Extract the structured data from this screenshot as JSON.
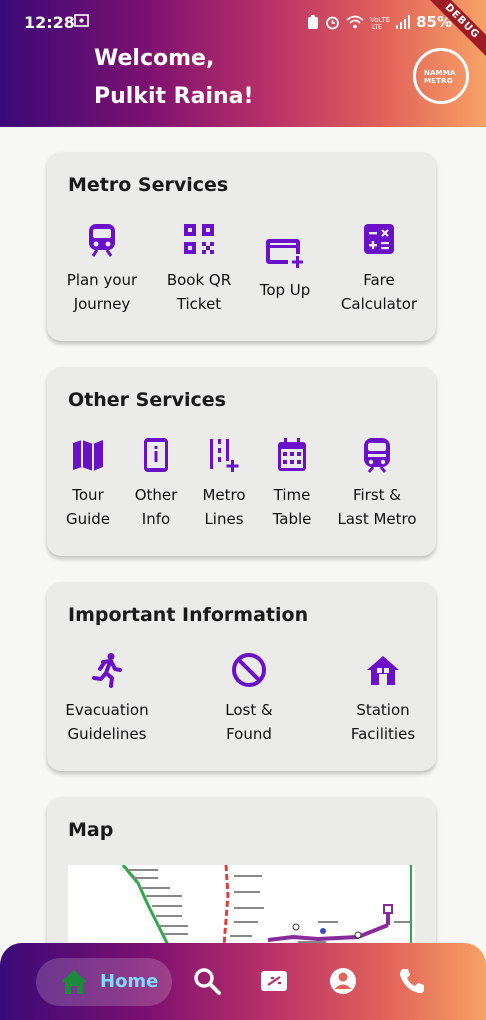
{
  "status": {
    "time": "12:28",
    "battery": "85%",
    "debug_banner": "DEBUG"
  },
  "header": {
    "welcome_line1": "Welcome,",
    "welcome_line2": "Pulkit Raina!",
    "logo_text_1": "NAMMA",
    "logo_text_2": "METRO"
  },
  "metro_services": {
    "title": "Metro Services",
    "items": [
      {
        "label": "Plan your\nJourney",
        "icon": "train-icon"
      },
      {
        "label": "Book QR\nTicket",
        "icon": "qr-code-icon"
      },
      {
        "label": "Top Up",
        "icon": "card-add-icon"
      },
      {
        "label": "Fare\nCalculator",
        "icon": "calculator-icon"
      }
    ]
  },
  "other_services": {
    "title": "Other Services",
    "items": [
      {
        "label": "Tour\nGuide",
        "icon": "map-icon"
      },
      {
        "label": "Other\nInfo",
        "icon": "info-phone-icon"
      },
      {
        "label": "Metro\nLines",
        "icon": "lines-add-icon"
      },
      {
        "label": "Time\nTable",
        "icon": "calendar-icon"
      },
      {
        "label": "First &\nLast Metro",
        "icon": "tram-icon"
      }
    ]
  },
  "important_info": {
    "title": "Important Information",
    "items": [
      {
        "label": "Evacuation\nGuidelines",
        "icon": "running-person-icon"
      },
      {
        "label": "Lost &\nFound",
        "icon": "block-icon"
      },
      {
        "label": "Station\nFacilities",
        "icon": "home-icon"
      }
    ]
  },
  "map": {
    "title": "Map"
  },
  "bottom_nav": {
    "home_label": "Home",
    "items": [
      "home-icon",
      "search-icon",
      "ticket-icon",
      "account-icon",
      "phone-icon"
    ]
  },
  "colors": {
    "accent": "#6a10c8",
    "nav_active_label": "#7fd8ff",
    "home_icon": "#1b8a3a"
  }
}
